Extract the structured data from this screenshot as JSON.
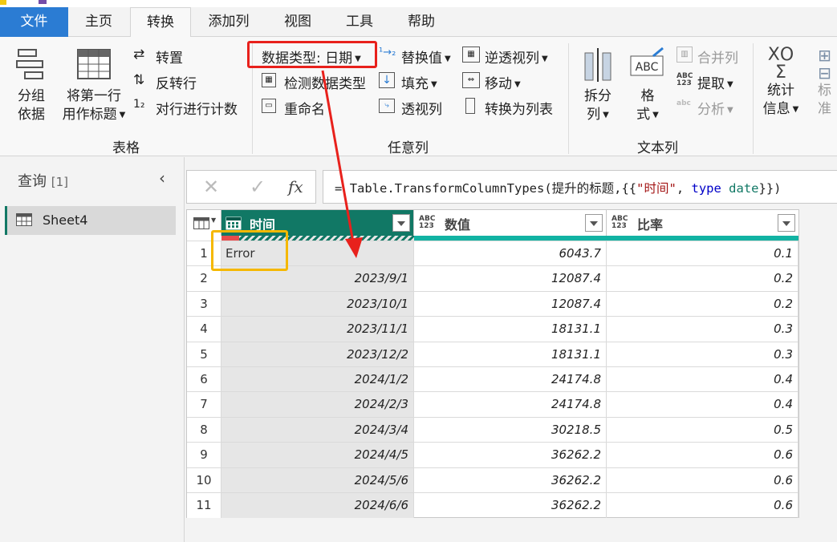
{
  "tabs": {
    "file": "文件",
    "home": "主页",
    "transform": "转换",
    "add_column": "添加列",
    "view": "视图",
    "tools": "工具",
    "help": "帮助"
  },
  "ribbon": {
    "group_by_1": "分组",
    "group_by_2": "依据",
    "use_first_row_1": "将第一行",
    "use_first_row_2": "用作标题",
    "transpose": "转置",
    "reverse_rows": "反转行",
    "count_rows": "对行进行计数",
    "data_type": "数据类型: 日期",
    "detect_type": "检测数据类型",
    "rename": "重命名",
    "replace_values": "替换值",
    "fill": "填充",
    "pivot": "透视列",
    "unpivot": "逆透视列",
    "move": "移动",
    "convert_to_list": "转换为列表",
    "split_1": "拆分",
    "split_2": "列",
    "format_1": "格",
    "format_2": "式",
    "merge_columns": "合并列",
    "extract": "提取",
    "parse": "分析",
    "stats_1": "统计",
    "stats_2": "信息",
    "standard_1": "标",
    "standard_2": "准",
    "group_table": "表格",
    "group_any_column": "任意列",
    "group_text_column": "文本列"
  },
  "queries": {
    "title": "查询",
    "count": "[1]",
    "item": "Sheet4"
  },
  "formula": {
    "fx": "fx",
    "eq": "=",
    "code_pre": "Table.TransformColumnTypes(提升的标题,{{",
    "str": "\"时间\"",
    "sep": ", ",
    "kw": "type",
    "type_name": "date",
    "code_post": "}})"
  },
  "columns": [
    {
      "name": "时间",
      "type_icon": "calendar-icon"
    },
    {
      "name": "数值",
      "type_icon_top": "ABC",
      "type_icon_bottom": "123"
    },
    {
      "name": "比率",
      "type_icon_top": "ABC",
      "type_icon_bottom": "123"
    }
  ],
  "rows": [
    {
      "n": "1",
      "date": "Error",
      "value": "6043.7",
      "rate": "0.1"
    },
    {
      "n": "2",
      "date": "2023/9/1",
      "value": "12087.4",
      "rate": "0.2"
    },
    {
      "n": "3",
      "date": "2023/10/1",
      "value": "12087.4",
      "rate": "0.2"
    },
    {
      "n": "4",
      "date": "2023/11/1",
      "value": "18131.1",
      "rate": "0.3"
    },
    {
      "n": "5",
      "date": "2023/12/2",
      "value": "18131.1",
      "rate": "0.3"
    },
    {
      "n": "6",
      "date": "2024/1/2",
      "value": "24174.8",
      "rate": "0.4"
    },
    {
      "n": "7",
      "date": "2024/2/3",
      "value": "24174.8",
      "rate": "0.4"
    },
    {
      "n": "8",
      "date": "2024/3/4",
      "value": "30218.5",
      "rate": "0.5"
    },
    {
      "n": "9",
      "date": "2024/4/5",
      "value": "36262.2",
      "rate": "0.6"
    },
    {
      "n": "10",
      "date": "2024/5/6",
      "value": "36262.2",
      "rate": "0.6"
    },
    {
      "n": "11",
      "date": "2024/6/6",
      "value": "36262.2",
      "rate": "0.6"
    }
  ],
  "colors": {
    "accent": "#2b7cd3",
    "date_header": "#117865",
    "quality_bar": "#12b3a3",
    "error_mark": "#e84c4c",
    "highlight_red": "#e8211c",
    "highlight_orange": "#f5b800"
  }
}
